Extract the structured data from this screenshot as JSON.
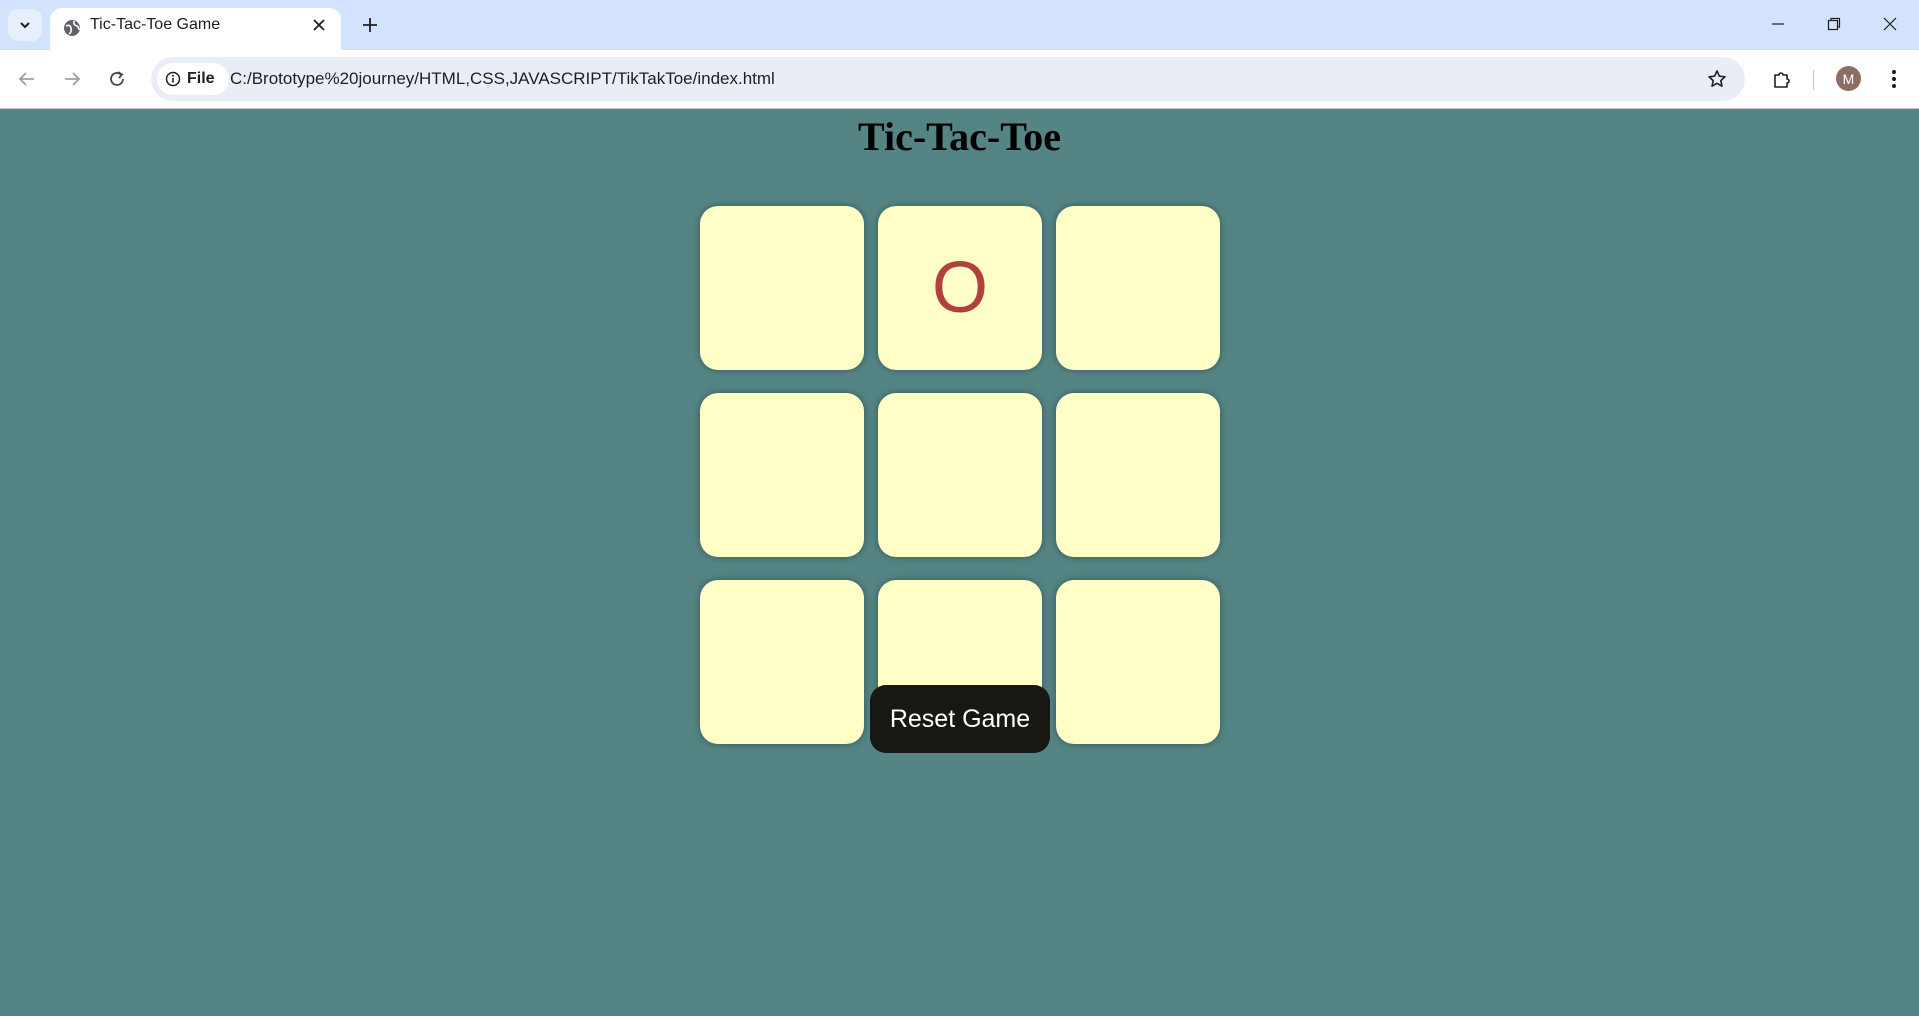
{
  "browser": {
    "tab_title": "Tic-Tac-Toe Game",
    "site_chip_label": "File",
    "url": "C:/Brototype%20journey/HTML,CSS,JAVASCRIPT/TikTakToe/index.html",
    "profile_initial": "M"
  },
  "game": {
    "title": "Tic-Tac-Toe",
    "board": [
      "",
      "O",
      "",
      "",
      "",
      "",
      "",
      "",
      ""
    ],
    "reset_label": "Reset Game"
  },
  "colors": {
    "page_background": "#548584",
    "cell_background": "#ffffc7",
    "mark_color": "#b0413e",
    "reset_button": "#191713"
  }
}
